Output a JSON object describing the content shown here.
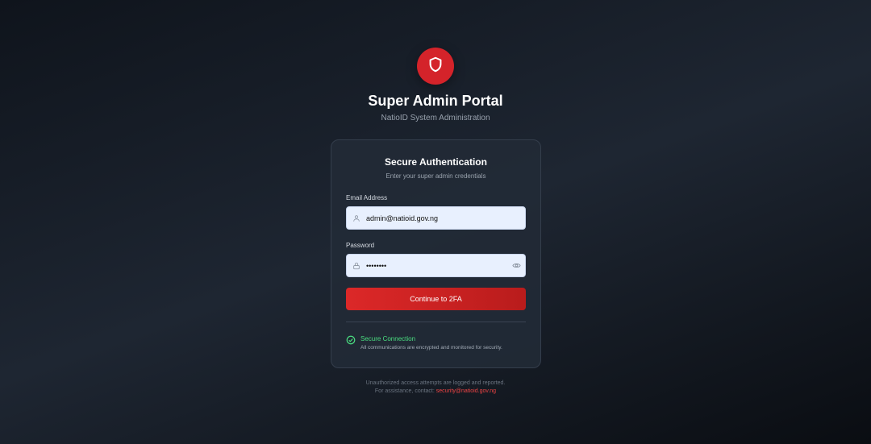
{
  "header": {
    "logo_icon": "shield-icon",
    "title": "Super Admin Portal",
    "subtitle": "NatioID System Administration"
  },
  "card": {
    "title": "Secure Authentication",
    "subtitle": "Enter your super admin credentials",
    "email": {
      "label": "Email Address",
      "value": "admin@natioid.gov.ng",
      "icon": "user-icon"
    },
    "password": {
      "label": "Password",
      "value": "••••••••",
      "icon": "lock-icon",
      "toggle_icon": "eye-icon"
    },
    "submit_label": "Continue to 2FA",
    "security": {
      "icon": "check-circle-icon",
      "title": "Secure Connection",
      "description": "All communications are encrypted and monitored for security."
    }
  },
  "footer": {
    "notice": "Unauthorized access attempts are logged and reported.",
    "contact_prefix": "For assistance, contact:",
    "contact_email": "security@natioid.gov.ng"
  },
  "colors": {
    "accent": "#dc2828",
    "success": "#4ade80",
    "background": "#1e2632"
  }
}
